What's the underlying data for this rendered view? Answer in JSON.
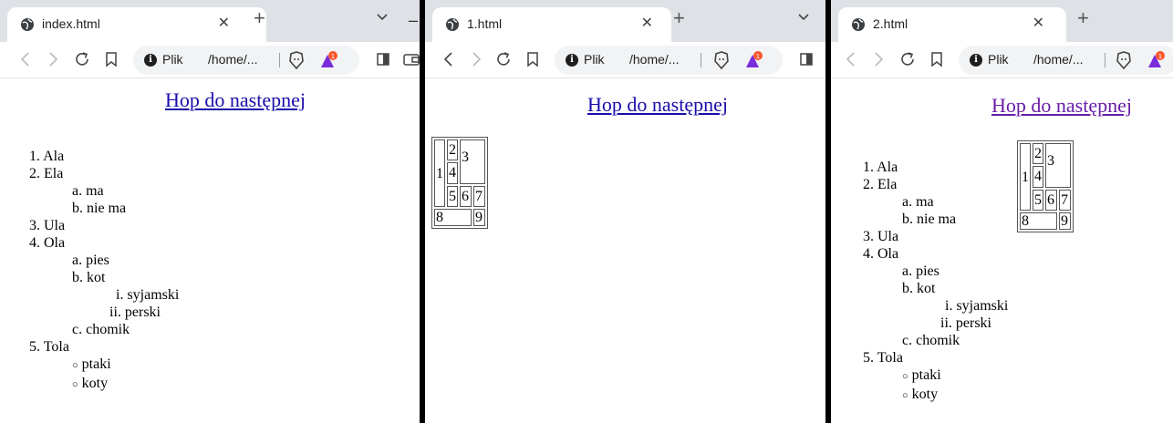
{
  "windows": [
    {
      "tab_title": "index.html",
      "plik": "Plik",
      "url": "/home/...",
      "link": "Hop do następnej",
      "list": [
        {
          "m": "1.",
          "t": "Ala"
        },
        {
          "m": "2.",
          "t": "Ela"
        },
        {
          "m": "a.",
          "t": "ma"
        },
        {
          "m": "b.",
          "t": "nie ma"
        },
        {
          "m": "3.",
          "t": "Ula"
        },
        {
          "m": "4.",
          "t": "Ola"
        },
        {
          "m": "a.",
          "t": "pies"
        },
        {
          "m": "b.",
          "t": "kot"
        },
        {
          "m": "i.",
          "t": "syjamski"
        },
        {
          "m": "ii.",
          "t": "perski"
        },
        {
          "m": "c.",
          "t": "chomik"
        },
        {
          "m": "5.",
          "t": "Tola"
        },
        {
          "m": "○",
          "t": "ptaki"
        },
        {
          "m": "○",
          "t": "koty"
        }
      ]
    },
    {
      "tab_title": "1.html",
      "plik": "Plik",
      "url": "/home/...",
      "link": "Hop do następnej",
      "table": [
        "1",
        "2",
        "3",
        "4",
        "5",
        "6",
        "7",
        "8",
        "9"
      ]
    },
    {
      "tab_title": "2.html",
      "plik": "Plik",
      "url": "/home/...",
      "link": "Hop do następnej",
      "table": [
        "1",
        "2",
        "3",
        "4",
        "5",
        "6",
        "7",
        "8",
        "9"
      ],
      "list": [
        {
          "m": "1.",
          "t": "Ala"
        },
        {
          "m": "2.",
          "t": "Ela"
        },
        {
          "m": "a.",
          "t": "ma"
        },
        {
          "m": "b.",
          "t": "nie ma"
        },
        {
          "m": "3.",
          "t": "Ula"
        },
        {
          "m": "4.",
          "t": "Ola"
        },
        {
          "m": "a.",
          "t": "pies"
        },
        {
          "m": "b.",
          "t": "kot"
        },
        {
          "m": "i.",
          "t": "syjamski"
        },
        {
          "m": "ii.",
          "t": "perski"
        },
        {
          "m": "c.",
          "t": "chomik"
        },
        {
          "m": "5.",
          "t": "Tola"
        },
        {
          "m": "○",
          "t": "ptaki"
        },
        {
          "m": "○",
          "t": "koty"
        }
      ]
    }
  ],
  "colors": {
    "link": "#1a0dab",
    "link_visited": "#681da8",
    "tabstrip": "#dee1e6",
    "omnibox": "#f1f3f4",
    "brave_badge": "#fb542b"
  },
  "icons": [
    "globe-icon",
    "close-icon",
    "new-tab-icon",
    "chevron-down-icon",
    "back-icon",
    "forward-icon",
    "reload-icon",
    "bookmark-icon",
    "info-icon",
    "brave-shields-icon",
    "brave-rewards-icon",
    "sidebar-icon",
    "wallet-icon",
    "minimize-icon"
  ]
}
